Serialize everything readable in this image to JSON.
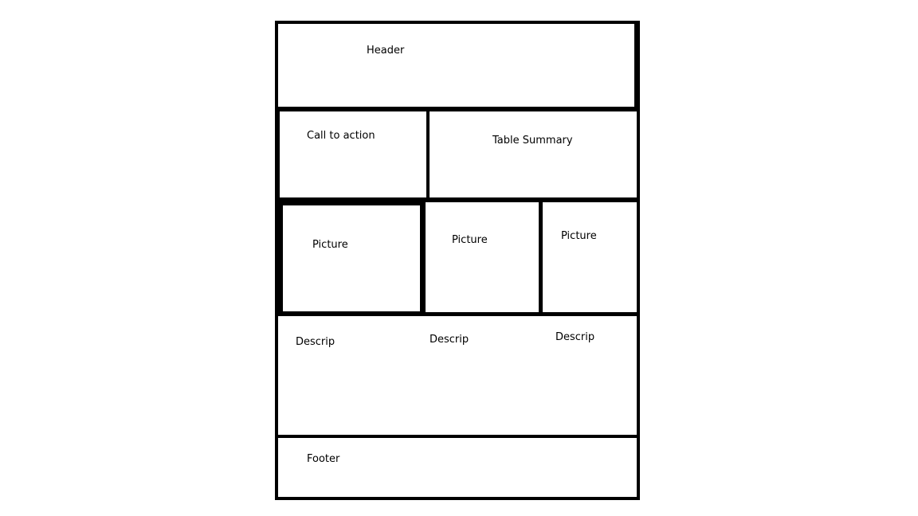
{
  "header": {
    "label": "Header"
  },
  "call_to_action": {
    "label": "Call to action"
  },
  "table_summary": {
    "label": "Table Summary"
  },
  "pictures": [
    {
      "label": "Picture"
    },
    {
      "label": "Picture"
    },
    {
      "label": "Picture"
    }
  ],
  "descriptions": [
    {
      "label": "Descrip"
    },
    {
      "label": "Descrip"
    },
    {
      "label": "Descrip"
    }
  ],
  "footer": {
    "label": "Footer"
  }
}
